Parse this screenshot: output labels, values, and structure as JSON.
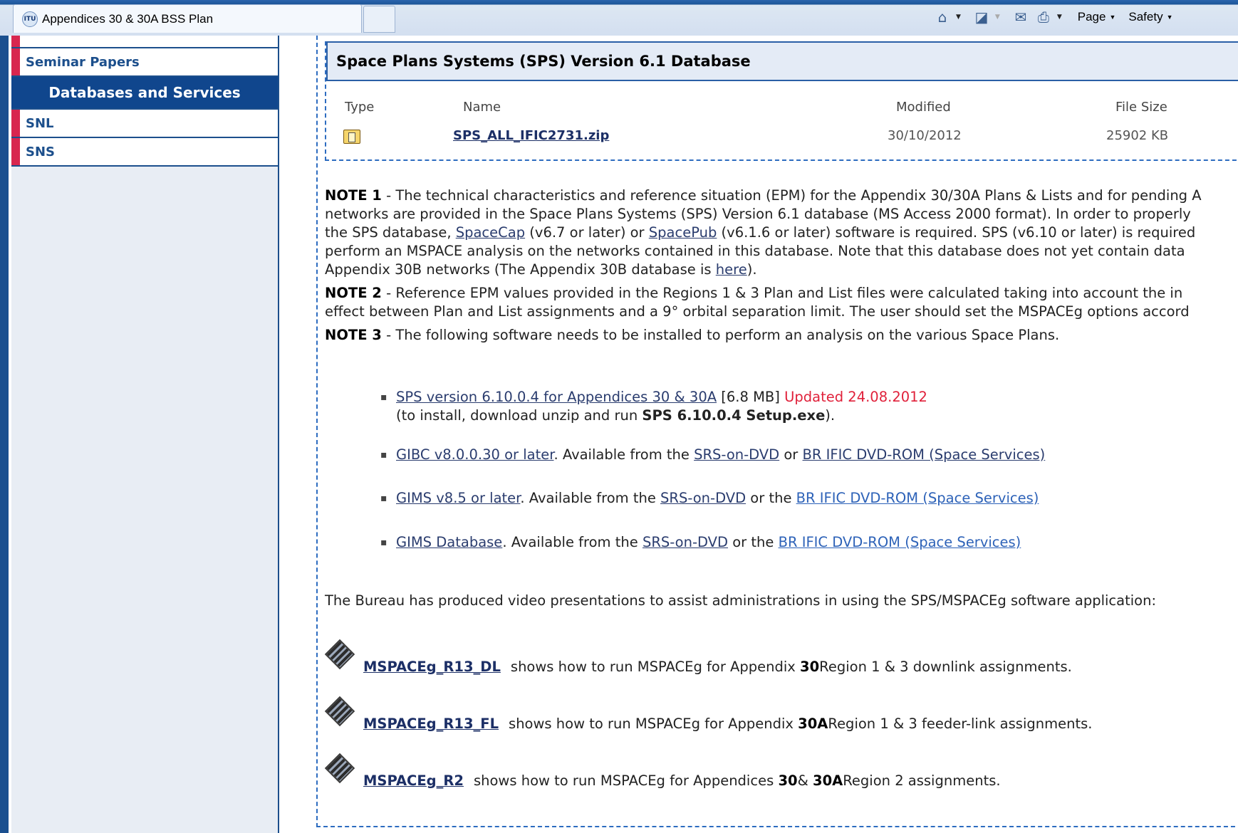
{
  "browser": {
    "tab_title": "Appendices 30 & 30A BSS Plan",
    "tab_logo_text": "ITU",
    "menus": {
      "page": "Page",
      "safety": "Safety"
    },
    "icons": [
      "home-icon",
      "rss-icon",
      "read-mail-icon",
      "print-icon"
    ]
  },
  "sidebar": {
    "items": [
      {
        "label": "Seminar Papers"
      },
      {
        "label": "Databases and Services",
        "header": true
      },
      {
        "label": "SNL"
      },
      {
        "label": "SNS"
      }
    ]
  },
  "database": {
    "title": "Space Plans Systems (SPS) Version 6.1 Database",
    "columns": [
      "Type",
      "Name",
      "Modified",
      "File Size"
    ],
    "rows": [
      {
        "type_icon": "zip-folder-icon",
        "name": "SPS_ALL_IFIC2731.zip",
        "modified": "30/10/2012",
        "size": "25902 KB"
      }
    ]
  },
  "notes": {
    "note1": {
      "label": "NOTE 1",
      "line1": " - The technical characteristics and reference situation (EPM) for the Appendix 30/30A Plans & Lists and for pending A",
      "line2": "networks are provided in the Space Plans Systems (SPS) Version 6.1 database (MS Access 2000 format). In order to properly",
      "line3_a": "the SPS database, ",
      "spacecap": "SpaceCap",
      "line3_b": " (v6.7 or later) or ",
      "spacepub": "SpacePub",
      "line3_c": " (v6.1.6 or later) software is required. SPS (v6.10 or later) is required",
      "line4": "perform an MSPACE analysis on the networks contained in this database. Note that this database does not yet contain data",
      "line5_a": "Appendix 30B networks (The Appendix 30B database is ",
      "here": "here",
      "line5_b": ")."
    },
    "note2": {
      "label": "NOTE 2",
      "line1": " - Reference EPM values provided in the Regions 1 & 3 Plan and List files were calculated taking into account the in",
      "line2": "effect between Plan and List assignments and a 9° orbital separation limit. The user should set the MSPACEg options accord"
    },
    "note3": {
      "label": "NOTE 3",
      "text": " - The following software needs to be installed to perform an analysis on the various Space Plans."
    }
  },
  "software": {
    "sps_link": "SPS version 6.10.0.4 for Appendices 30 & 30A",
    "sps_size": " [6.8 MB] ",
    "sps_updated": "Updated 24.08.2012",
    "sps_install_a": "(to install, download unzip and run ",
    "sps_install_b": "SPS 6.10.0.4 Setup.exe",
    "sps_install_c": ").",
    "gibc_link": "GIBC v8.0.0.30 or later",
    "gibc_text": ".  Available from the ",
    "srs_dvd": "SRS-on-DVD",
    "or": " or ",
    "or_the": " or the ",
    "br_ific": "BR IFIC DVD-ROM (Space Services)",
    "gims_link": "GIMS v8.5 or later",
    "gims_text": ".  Available from the ",
    "gimsdb_link": "GIMS Database",
    "gimsdb_text": ". Available from the "
  },
  "videos": {
    "intro": "The Bureau has produced video presentations to assist administrations in using the SPS/MSPACEg software application:",
    "items": [
      {
        "link": "MSPACEg_R13_DL",
        "text_a": "shows how to run MSPACEg for Appendix ",
        "bold1": "30",
        "text_b": " Region 1 & 3 downlink assignments.",
        "bold2": "",
        "text_c": ""
      },
      {
        "link": "MSPACEg_R13_FL",
        "text_a": "shows how to run MSPACEg for Appendix ",
        "bold1": "30A",
        "text_b": " Region 1 & 3 feeder-link assignments.",
        "bold2": "",
        "text_c": ""
      },
      {
        "link": "MSPACEg_R2",
        "text_a": "shows how to run MSPACEg for Appendices ",
        "bold1": "30",
        "text_b": " & ",
        "bold2": "30A",
        "text_c": " Region 2 assignments."
      }
    ]
  }
}
